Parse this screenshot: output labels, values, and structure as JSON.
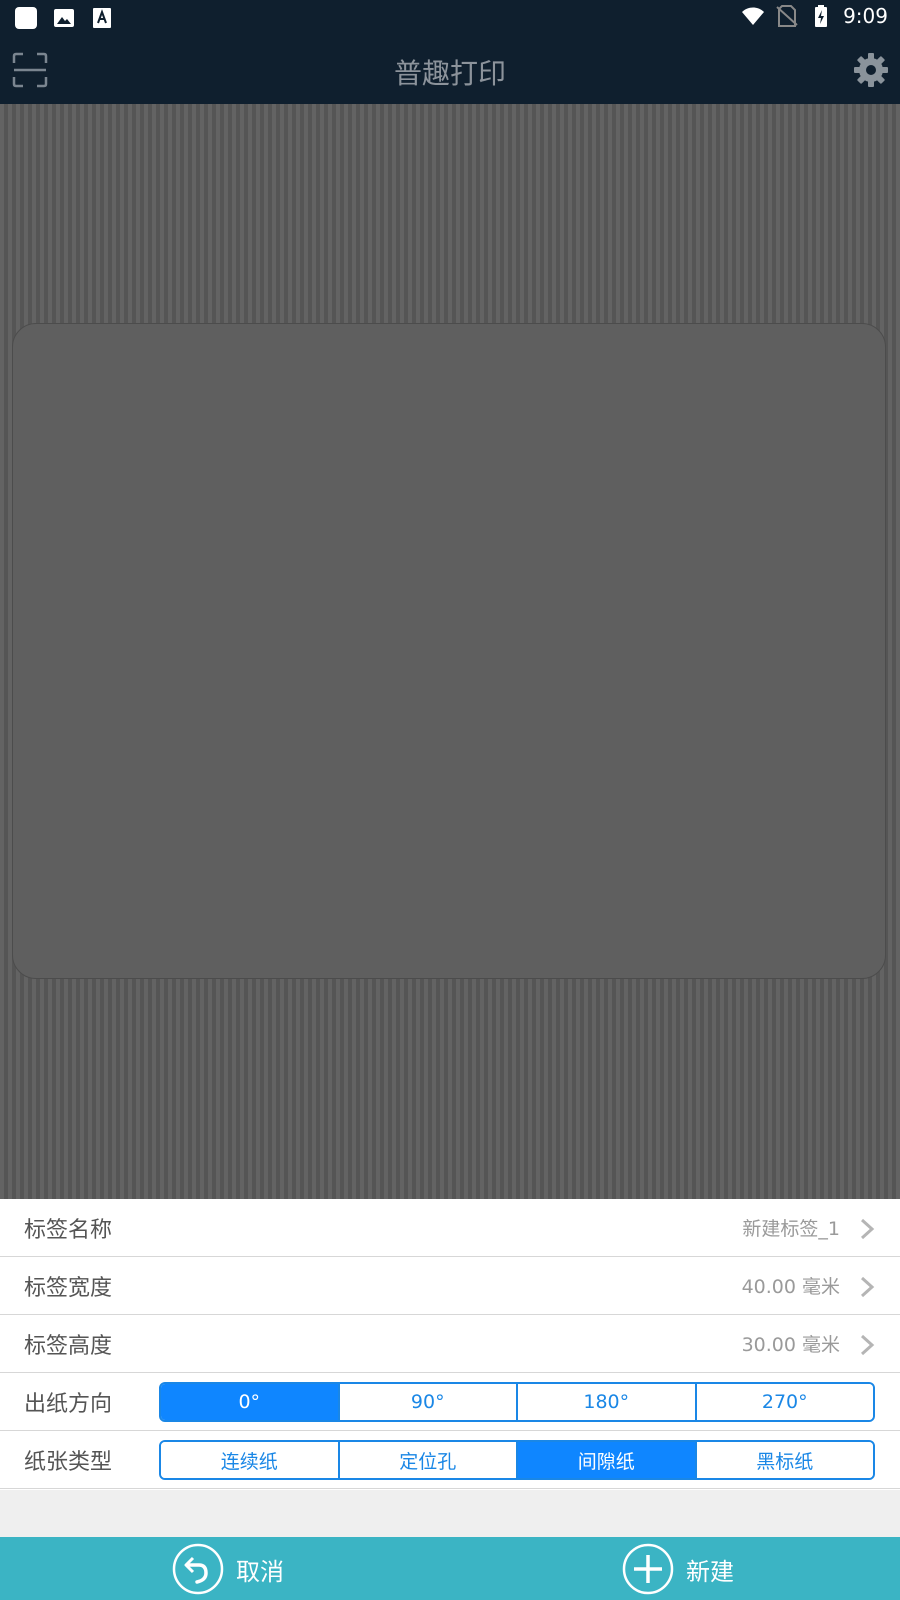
{
  "status_bar": {
    "time": "9:09",
    "icons": [
      "app-square-icon",
      "image-icon",
      "text-a-icon",
      "wifi-icon",
      "no-sim-icon",
      "battery-charging-icon"
    ]
  },
  "header": {
    "title": "普趣打印",
    "left_icon": "scan-frame-icon",
    "right_icon": "gear-icon"
  },
  "settings": {
    "name": {
      "label": "标签名称",
      "value": "新建标签_1"
    },
    "width": {
      "label": "标签宽度",
      "value": "40.00 毫米"
    },
    "height": {
      "label": "标签高度",
      "value": "30.00 毫米"
    },
    "direction": {
      "label": "出纸方向",
      "options": [
        "0°",
        "90°",
        "180°",
        "270°"
      ],
      "selected": "0°"
    },
    "paper_type": {
      "label": "纸张类型",
      "options": [
        "连续纸",
        "定位孔",
        "间隙纸",
        "黑标纸"
      ],
      "selected": "间隙纸"
    }
  },
  "bottom_bar": {
    "cancel_label": "取消",
    "create_label": "新建"
  },
  "colors": {
    "header_bg": "#0f1f2e",
    "accent_blue": "#0f86ff",
    "bottom_bar": "#3bb4c4"
  }
}
